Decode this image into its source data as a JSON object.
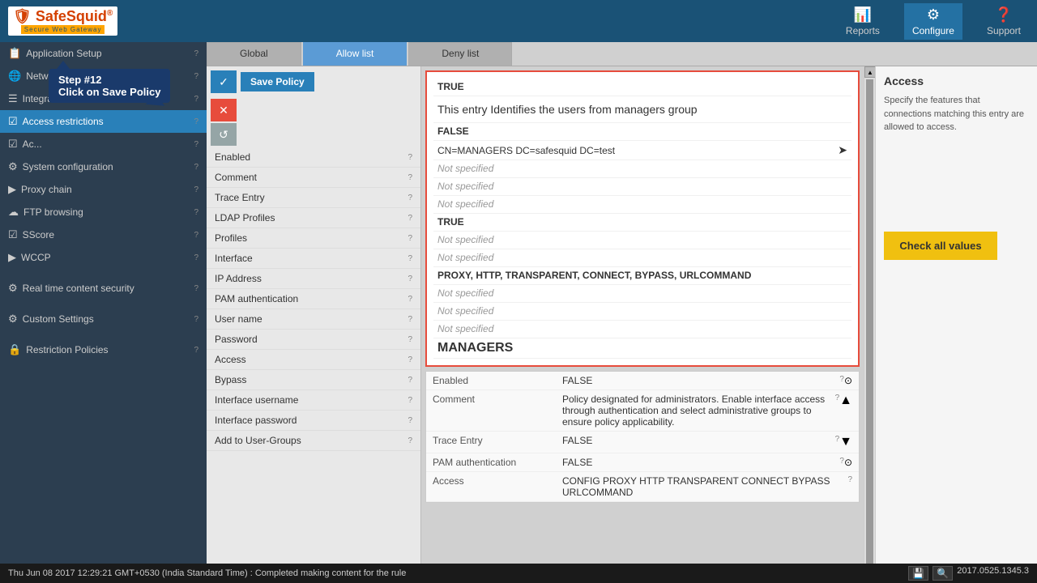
{
  "app": {
    "name": "SafeSquid",
    "subtitle": "Secure Web Gateway",
    "version": "2017.0525.1345.3"
  },
  "header": {
    "nav_items": [
      {
        "id": "reports",
        "label": "Reports",
        "icon": "📊"
      },
      {
        "id": "configure",
        "label": "Configure",
        "icon": "⚙"
      },
      {
        "id": "support",
        "label": "Support",
        "icon": "❓"
      }
    ]
  },
  "sidebar": {
    "sections": [
      {
        "id": "app-setup",
        "items": [
          {
            "id": "application-setup",
            "icon": "📋",
            "label": "Application Setup",
            "active": false
          },
          {
            "id": "network-settings",
            "icon": "🌐",
            "label": "Network settings",
            "active": false
          },
          {
            "id": "integrate-ldap",
            "icon": "☰",
            "label": "Integrate LDAP",
            "active": false
          },
          {
            "id": "access-restrictions",
            "icon": "☑",
            "label": "Access restrictions",
            "active": true
          },
          {
            "id": "ac2",
            "icon": "☑",
            "label": "Ac...",
            "active": false
          },
          {
            "id": "system-configuration",
            "icon": "⚙",
            "label": "System configuration",
            "active": false
          },
          {
            "id": "proxy-chain",
            "icon": "▶",
            "label": "Proxy chain",
            "active": false
          },
          {
            "id": "ftp-browsing",
            "icon": "☁",
            "label": "FTP browsing",
            "active": false
          },
          {
            "id": "sscore",
            "icon": "☑",
            "label": "SScore",
            "active": false
          },
          {
            "id": "wccp",
            "icon": "▶",
            "label": "WCCP",
            "active": false
          }
        ]
      },
      {
        "id": "security",
        "items": [
          {
            "id": "real-time-content-security",
            "icon": "⚙",
            "label": "Real time content security",
            "active": false
          }
        ]
      },
      {
        "id": "custom",
        "items": [
          {
            "id": "custom-settings",
            "icon": "⚙",
            "label": "Custom Settings",
            "active": false
          }
        ]
      },
      {
        "id": "restriction",
        "items": [
          {
            "id": "restriction-policies",
            "icon": "🔒",
            "label": "Restriction Policies",
            "active": false
          }
        ]
      }
    ]
  },
  "tabs": {
    "items": [
      {
        "id": "global",
        "label": "Global",
        "active": false
      },
      {
        "id": "allow-list",
        "label": "Allow list",
        "active": true
      },
      {
        "id": "deny-list",
        "label": "Deny list",
        "active": false
      }
    ]
  },
  "action_buttons": {
    "save_policy": "Save Policy",
    "icons": [
      "✓",
      "✕",
      "↺"
    ]
  },
  "field_list": {
    "items": [
      {
        "id": "enabled",
        "label": "Enabled"
      },
      {
        "id": "comment",
        "label": "Comment"
      },
      {
        "id": "trace-entry",
        "label": "Trace Entry"
      },
      {
        "id": "ldap-profiles",
        "label": "LDAP Profiles"
      },
      {
        "id": "profiles",
        "label": "Profiles"
      },
      {
        "id": "interface",
        "label": "Interface"
      },
      {
        "id": "ip-address",
        "label": "IP Address"
      },
      {
        "id": "pam-authentication",
        "label": "PAM authentication"
      },
      {
        "id": "user-name",
        "label": "User name"
      },
      {
        "id": "password",
        "label": "Password"
      },
      {
        "id": "access",
        "label": "Access"
      },
      {
        "id": "bypass",
        "label": "Bypass"
      },
      {
        "id": "interface-username",
        "label": "Interface username"
      },
      {
        "id": "interface-password",
        "label": "Interface password"
      },
      {
        "id": "add-to-user-groups",
        "label": "Add to User-Groups"
      }
    ]
  },
  "entry_card": {
    "enabled": "TRUE",
    "comment": "This entry Identifies the users from managers group",
    "trace_entry": "FALSE",
    "ldap_value": "CN=MANAGERS DC=safesquid DC=test",
    "profiles_not_specified": "Not specified",
    "interface_not_specified": "Not specified",
    "ip_not_specified": "Not specified",
    "pam_true": "TRUE",
    "username_not_specified": "Not specified",
    "password_not_specified": "Not specified",
    "access_value": "PROXY,  HTTP,  TRANSPARENT,  CONNECT,  BYPASS,  URLCOMMAND",
    "bypass_not_specified": "Not specified",
    "interface_username_not_specified": "Not specified",
    "interface_password_not_specified": "Not specified",
    "add_to_groups": "MANAGERS"
  },
  "entry2": {
    "enabled_label": "Enabled",
    "enabled_value": "FALSE",
    "enabled_help": "?",
    "comment_label": "Comment",
    "comment_value": "Policy designated for administrators. Enable interface access through authentication and select administrative groups to ensure policy applicability.",
    "comment_help": "?",
    "trace_entry_label": "Trace Entry",
    "trace_entry_value": "FALSE",
    "trace_entry_help": "?",
    "pam_label": "PAM authentication",
    "pam_value": "FALSE",
    "pam_help": "?",
    "access_label": "Access",
    "access_value": "CONFIG PROXY HTTP TRANSPARENT CONNECT BYPASS URLCOMMAND",
    "access_help": "?"
  },
  "right_panel": {
    "title": "Access",
    "description": "Specify the features that connections matching this entry are allowed to access.",
    "check_btn": "Check all values"
  },
  "tooltip": {
    "step": "Step #12",
    "action": "Click on Save Policy"
  },
  "status_bar": {
    "text": "Thu Jun 08 2017 12:29:21 GMT+0530 (India Standard Time) : Completed making content for the rule",
    "version": "2017.0525.1345.3"
  }
}
